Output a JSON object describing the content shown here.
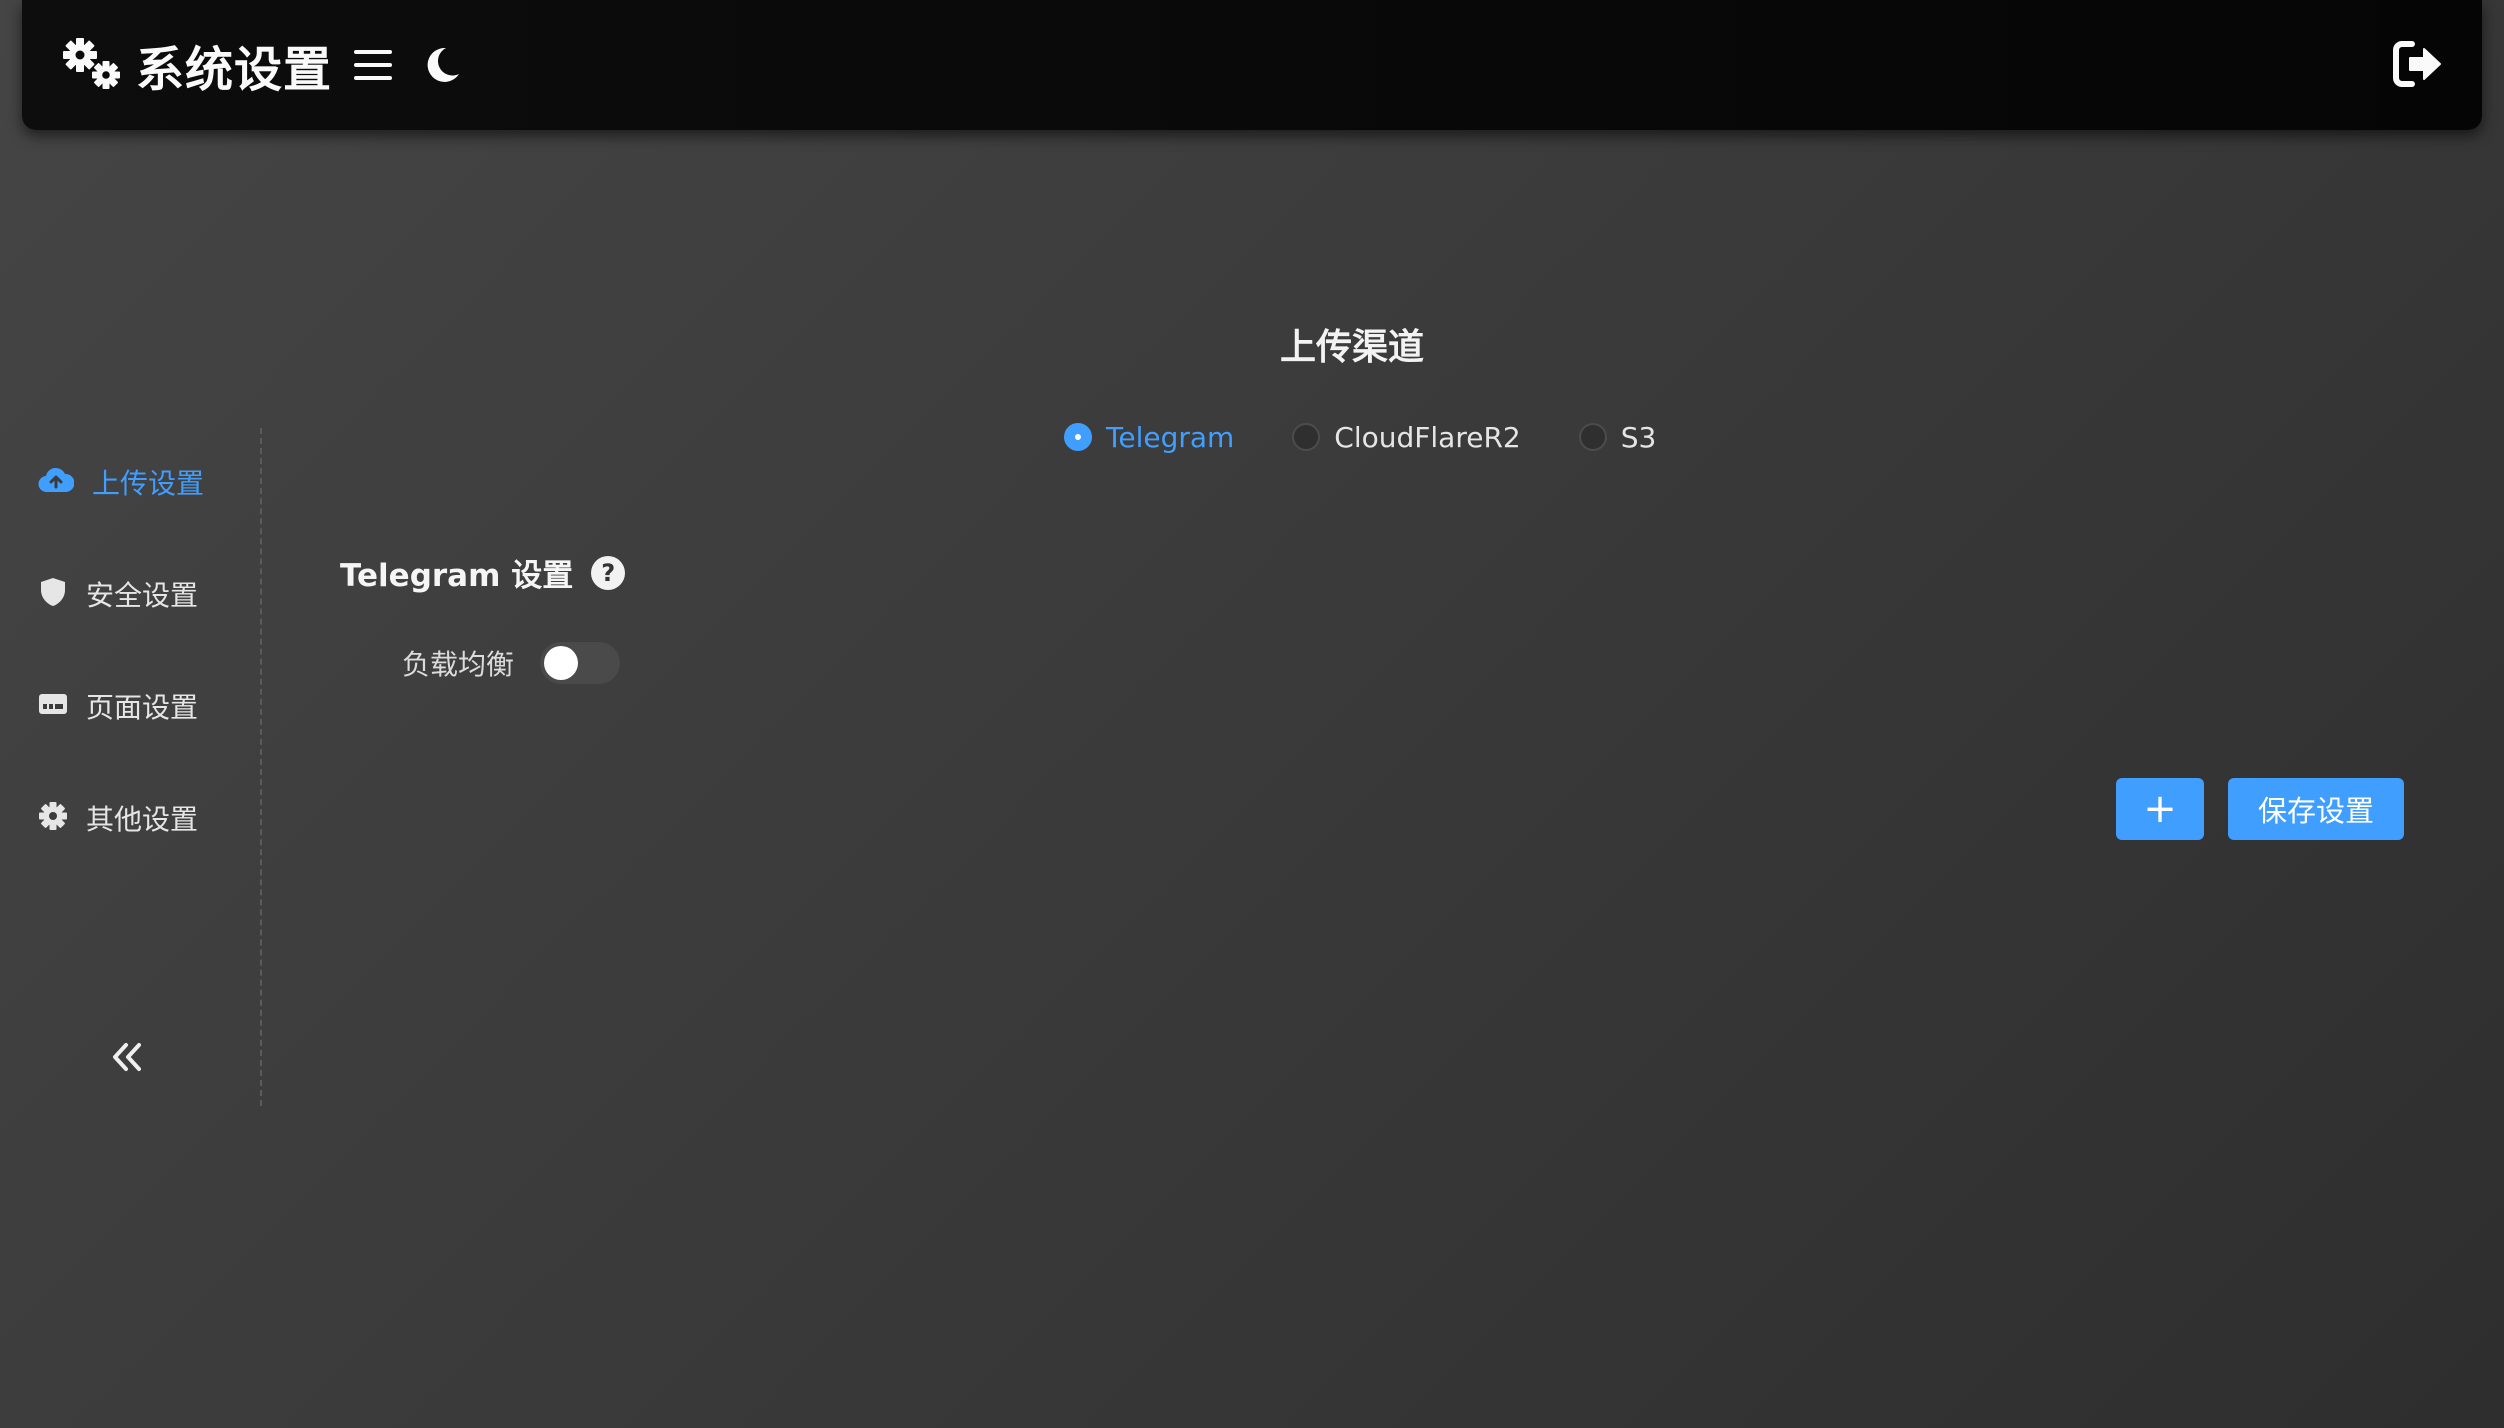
{
  "header": {
    "title": "系统设置",
    "icons": {
      "brand": "gears-icon",
      "menu": "hamburger-icon",
      "theme": "moon-icon",
      "logout": "logout-icon"
    }
  },
  "sidebar": {
    "items": [
      {
        "label": "上传设置",
        "icon": "cloud-upload-icon",
        "active": true
      },
      {
        "label": "安全设置",
        "icon": "shield-icon",
        "active": false
      },
      {
        "label": "页面设置",
        "icon": "window-icon",
        "active": false
      },
      {
        "label": "其他设置",
        "icon": "gear-icon",
        "active": false
      }
    ],
    "collapse_icon": "double-chevron-left-icon"
  },
  "main": {
    "channel_title": "上传渠道",
    "channels": [
      {
        "label": "Telegram",
        "checked": true
      },
      {
        "label": "CloudFlareR2",
        "checked": false
      },
      {
        "label": "S3",
        "checked": false
      }
    ],
    "section_title": "Telegram 设置",
    "help_glyph": "?",
    "load_balance": {
      "label": "负载均衡",
      "enabled": false
    },
    "add_button": "+",
    "save_button": "保存设置"
  },
  "colors": {
    "accent": "#409eff",
    "header_bg": "#0a0a0a",
    "page_bg": "#3b3b3b"
  }
}
